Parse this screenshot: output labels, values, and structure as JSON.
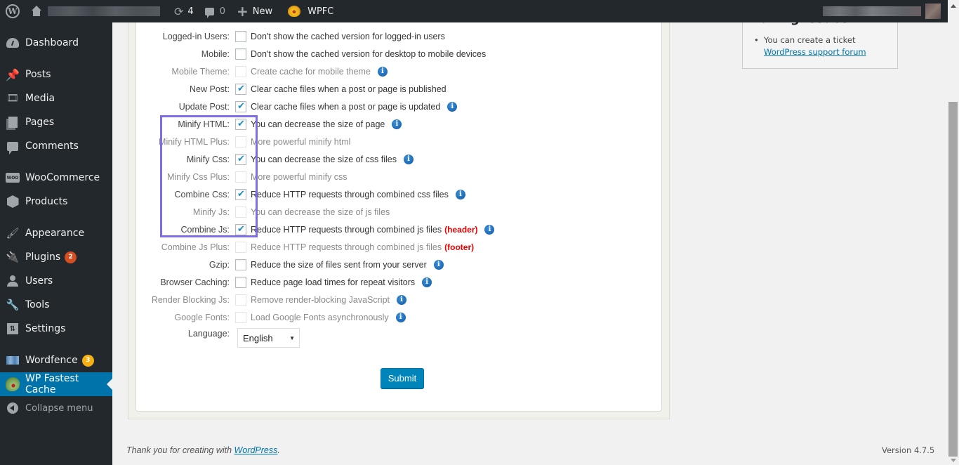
{
  "adminbar": {
    "site_name": "[blurred site name]",
    "updates_count": "4",
    "comments_count": "0",
    "new_label": "New",
    "plugin_label": "WPFC",
    "user_name": "[blurred user name]"
  },
  "sidebar": {
    "items": [
      {
        "label": "Dashboard",
        "icon": "dashboard-icon"
      },
      {
        "label": "Posts",
        "icon": "pin-icon"
      },
      {
        "label": "Media",
        "icon": "media-icon"
      },
      {
        "label": "Pages",
        "icon": "pages-icon"
      },
      {
        "label": "Comments",
        "icon": "comments-icon"
      },
      {
        "label": "WooCommerce",
        "icon": "woocommerce-icon"
      },
      {
        "label": "Products",
        "icon": "box-icon"
      },
      {
        "label": "Appearance",
        "icon": "paintbrush-icon"
      },
      {
        "label": "Plugins",
        "icon": "plug-icon",
        "badge": "2"
      },
      {
        "label": "Users",
        "icon": "user-icon"
      },
      {
        "label": "Tools",
        "icon": "wrench-icon"
      },
      {
        "label": "Settings",
        "icon": "settings-icon"
      },
      {
        "label": "Wordfence",
        "icon": "wordfence-icon",
        "badge": "3"
      },
      {
        "label": "WP Fastest Cache",
        "icon": "tiger-icon",
        "current": true
      },
      {
        "label": "Collapse menu",
        "icon": "collapse-icon"
      }
    ]
  },
  "settings": {
    "rows": [
      {
        "label": "Logged-in Users:",
        "desc": "Don't show the cached version for logged-in users",
        "checked": false,
        "disabled": false,
        "info": false
      },
      {
        "label": "Mobile:",
        "desc": "Don't show the cached version for desktop to mobile devices",
        "checked": false,
        "disabled": false,
        "info": false
      },
      {
        "label": "Mobile Theme:",
        "desc": "Create cache for mobile theme",
        "checked": false,
        "disabled": true,
        "info": true
      },
      {
        "label": "New Post:",
        "desc": "Clear cache files when a post or page is published",
        "checked": true,
        "disabled": false,
        "info": false
      },
      {
        "label": "Update Post:",
        "desc": "Clear cache files when a post or page is updated",
        "checked": true,
        "disabled": false,
        "info": true
      },
      {
        "label": "Minify HTML:",
        "desc": "You can decrease the size of page",
        "checked": true,
        "disabled": false,
        "info": true
      },
      {
        "label": "Minify HTML Plus:",
        "desc": "More powerful minify html",
        "checked": false,
        "disabled": true,
        "info": false
      },
      {
        "label": "Minify Css:",
        "desc": "You can decrease the size of css files",
        "checked": true,
        "disabled": false,
        "info": true
      },
      {
        "label": "Minify Css Plus:",
        "desc": "More powerful minify css",
        "checked": false,
        "disabled": true,
        "info": false
      },
      {
        "label": "Combine Css:",
        "desc": "Reduce HTTP requests through combined css files",
        "checked": true,
        "disabled": false,
        "info": true
      },
      {
        "label": "Minify Js:",
        "desc": "You can decrease the size of js files",
        "checked": false,
        "disabled": true,
        "info": false
      },
      {
        "label": "Combine Js:",
        "desc": "Reduce HTTP requests through combined js files",
        "tag": "(header)",
        "checked": true,
        "disabled": false,
        "info": true
      },
      {
        "label": "Combine Js Plus:",
        "desc": "Reduce HTTP requests through combined js files",
        "tag": "(footer)",
        "checked": false,
        "disabled": true,
        "info": false
      },
      {
        "label": "Gzip:",
        "desc": "Reduce the size of files sent from your server",
        "checked": false,
        "disabled": false,
        "info": true
      },
      {
        "label": "Browser Caching:",
        "desc": "Reduce page load times for repeat visitors",
        "checked": false,
        "disabled": false,
        "info": true
      },
      {
        "label": "Render Blocking Js:",
        "desc": "Remove render-blocking JavaScript",
        "checked": false,
        "disabled": true,
        "info": true
      },
      {
        "label": "Google Fonts:",
        "desc": "Load Google Fonts asynchronously",
        "checked": false,
        "disabled": true,
        "info": true
      }
    ],
    "language": {
      "label": "Language:",
      "value": "English"
    },
    "submit_label": "Submit"
  },
  "help": {
    "title": "Having Issues?",
    "item_text": "You can create a ticket",
    "link_text": "WordPress support forum"
  },
  "footer": {
    "thanks_prefix": "Thank you for creating with ",
    "thanks_link": "WordPress",
    "thanks_suffix": ".",
    "version": "Version 4.7.5"
  },
  "colors": {
    "accent": "#0073aa",
    "highlight_box": "#7c6fe6",
    "tag_red": "#ee0000",
    "badge_plugins": "#d54e21",
    "badge_wordfence": "#f7b012"
  }
}
